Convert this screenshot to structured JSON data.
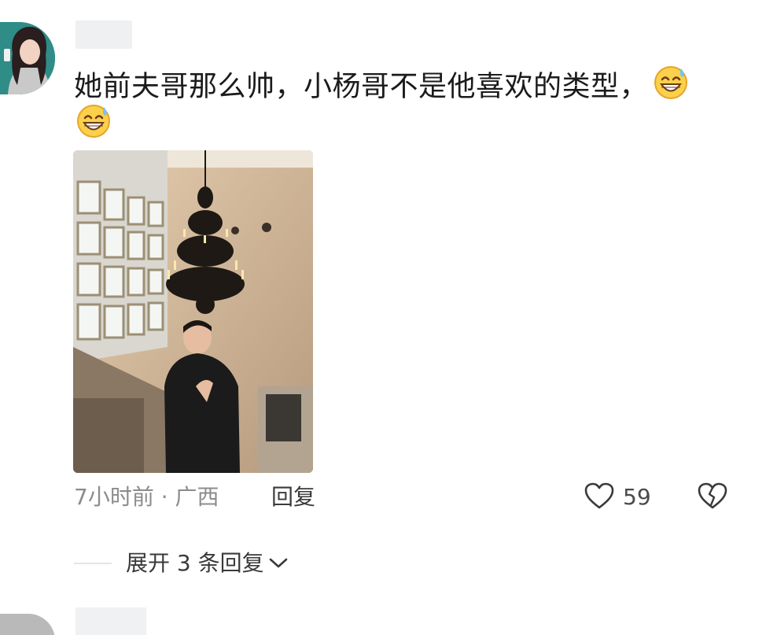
{
  "comment": {
    "text": "她前夫哥那么帅，小杨哥不是他喜欢的类型，",
    "emoji": "grinning-sweat-emoji",
    "time_location": "7小时前 · 广西",
    "reply_label": "回复",
    "like_count": "59"
  },
  "replies": {
    "expand_label": "展开 3 条回复"
  },
  "icons": {
    "like": "heart-icon",
    "dislike": "broken-heart-icon",
    "expand": "chevron-down-icon"
  },
  "colors": {
    "text": "#1b1b1b",
    "meta": "#8c8c8c",
    "avatar_bg": "#2f8c87"
  }
}
